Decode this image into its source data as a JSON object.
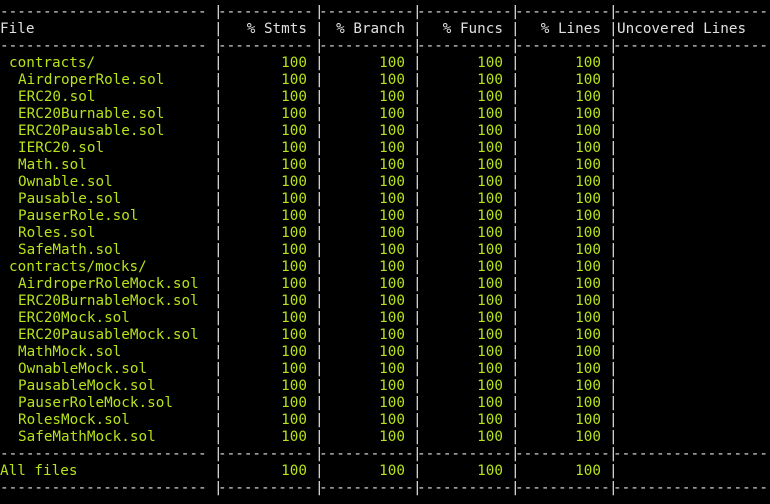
{
  "colors": {
    "background": "#000000",
    "text": "#e0e0e0",
    "covered": "#b7e31a"
  },
  "header": {
    "file": "File",
    "stmts": "% Stmts",
    "branch": "% Branch",
    "funcs": "% Funcs",
    "lines": "% Lines",
    "uncovered": "Uncovered Lines"
  },
  "rows": [
    {
      "name": "contracts/",
      "kind": "dir",
      "stmts": "100",
      "branch": "100",
      "funcs": "100",
      "lines": "100",
      "uncovered": ""
    },
    {
      "name": "AirdroperRole.sol",
      "kind": "file",
      "stmts": "100",
      "branch": "100",
      "funcs": "100",
      "lines": "100",
      "uncovered": ""
    },
    {
      "name": "ERC20.sol",
      "kind": "file",
      "stmts": "100",
      "branch": "100",
      "funcs": "100",
      "lines": "100",
      "uncovered": ""
    },
    {
      "name": "ERC20Burnable.sol",
      "kind": "file",
      "stmts": "100",
      "branch": "100",
      "funcs": "100",
      "lines": "100",
      "uncovered": ""
    },
    {
      "name": "ERC20Pausable.sol",
      "kind": "file",
      "stmts": "100",
      "branch": "100",
      "funcs": "100",
      "lines": "100",
      "uncovered": ""
    },
    {
      "name": "IERC20.sol",
      "kind": "file",
      "stmts": "100",
      "branch": "100",
      "funcs": "100",
      "lines": "100",
      "uncovered": ""
    },
    {
      "name": "Math.sol",
      "kind": "file",
      "stmts": "100",
      "branch": "100",
      "funcs": "100",
      "lines": "100",
      "uncovered": ""
    },
    {
      "name": "Ownable.sol",
      "kind": "file",
      "stmts": "100",
      "branch": "100",
      "funcs": "100",
      "lines": "100",
      "uncovered": ""
    },
    {
      "name": "Pausable.sol",
      "kind": "file",
      "stmts": "100",
      "branch": "100",
      "funcs": "100",
      "lines": "100",
      "uncovered": ""
    },
    {
      "name": "PauserRole.sol",
      "kind": "file",
      "stmts": "100",
      "branch": "100",
      "funcs": "100",
      "lines": "100",
      "uncovered": ""
    },
    {
      "name": "Roles.sol",
      "kind": "file",
      "stmts": "100",
      "branch": "100",
      "funcs": "100",
      "lines": "100",
      "uncovered": ""
    },
    {
      "name": "SafeMath.sol",
      "kind": "file",
      "stmts": "100",
      "branch": "100",
      "funcs": "100",
      "lines": "100",
      "uncovered": ""
    },
    {
      "name": "contracts/mocks/",
      "kind": "dir",
      "stmts": "100",
      "branch": "100",
      "funcs": "100",
      "lines": "100",
      "uncovered": ""
    },
    {
      "name": "AirdroperRoleMock.sol",
      "kind": "file",
      "stmts": "100",
      "branch": "100",
      "funcs": "100",
      "lines": "100",
      "uncovered": ""
    },
    {
      "name": "ERC20BurnableMock.sol",
      "kind": "file",
      "stmts": "100",
      "branch": "100",
      "funcs": "100",
      "lines": "100",
      "uncovered": ""
    },
    {
      "name": "ERC20Mock.sol",
      "kind": "file",
      "stmts": "100",
      "branch": "100",
      "funcs": "100",
      "lines": "100",
      "uncovered": ""
    },
    {
      "name": "ERC20PausableMock.sol",
      "kind": "file",
      "stmts": "100",
      "branch": "100",
      "funcs": "100",
      "lines": "100",
      "uncovered": ""
    },
    {
      "name": "MathMock.sol",
      "kind": "file",
      "stmts": "100",
      "branch": "100",
      "funcs": "100",
      "lines": "100",
      "uncovered": ""
    },
    {
      "name": "OwnableMock.sol",
      "kind": "file",
      "stmts": "100",
      "branch": "100",
      "funcs": "100",
      "lines": "100",
      "uncovered": ""
    },
    {
      "name": "PausableMock.sol",
      "kind": "file",
      "stmts": "100",
      "branch": "100",
      "funcs": "100",
      "lines": "100",
      "uncovered": ""
    },
    {
      "name": "PauserRoleMock.sol",
      "kind": "file",
      "stmts": "100",
      "branch": "100",
      "funcs": "100",
      "lines": "100",
      "uncovered": ""
    },
    {
      "name": "RolesMock.sol",
      "kind": "file",
      "stmts": "100",
      "branch": "100",
      "funcs": "100",
      "lines": "100",
      "uncovered": ""
    },
    {
      "name": "SafeMathMock.sol",
      "kind": "file",
      "stmts": "100",
      "branch": "100",
      "funcs": "100",
      "lines": "100",
      "uncovered": ""
    }
  ],
  "total": {
    "name": "All files",
    "stmts": "100",
    "branch": "100",
    "funcs": "100",
    "lines": "100",
    "uncovered": ""
  }
}
